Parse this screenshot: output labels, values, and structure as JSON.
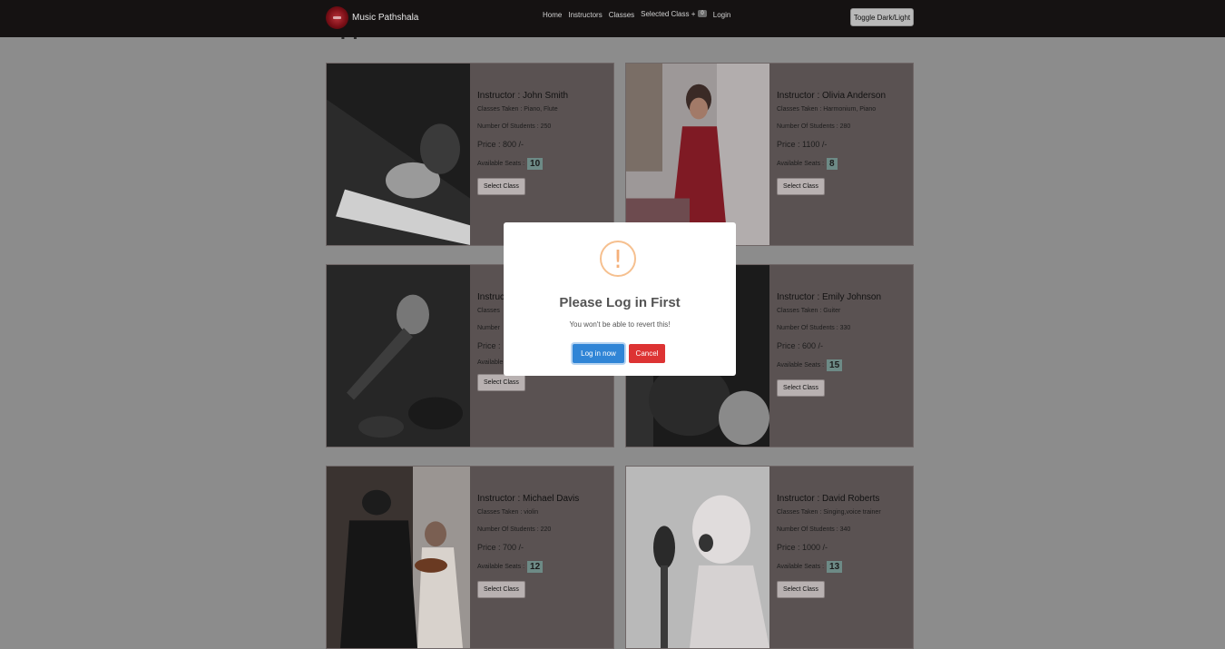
{
  "nav": {
    "brand": "Music Pathshala",
    "links": [
      "Home",
      "Instructors",
      "Classes"
    ],
    "selected_label": "Selected Class +",
    "selected_count": "0",
    "login": "Login",
    "toggle": "Toggle Dark/Light"
  },
  "cards": [
    {
      "instructor": "Instructor : John Smith",
      "classes": "Classes Taken : Piano, Flute",
      "students": "Number Of Students : 250",
      "price": "Price : 800 /-",
      "seats_label": "Available Seats :",
      "seats": "10",
      "button": "Select Class",
      "image": "piano-hands-photo"
    },
    {
      "instructor": "Instructor : Olivia Anderson",
      "classes": "Classes Taken : Harmonium, Piano",
      "students": "Number Of Students : 280",
      "price": "Price : 1100 /-",
      "seats_label": "Available Seats :",
      "seats": "8",
      "button": "Select Class",
      "image": "girl-harmonium-photo"
    },
    {
      "instructor": "Instructor :",
      "classes": "Classes",
      "students": "Number",
      "price": "Price :",
      "seats_label": "Available",
      "seats": "",
      "button": "Select Class",
      "image": "microphone-photo"
    },
    {
      "instructor": "Instructor : Emily Johnson",
      "classes": "Classes Taken : Guiter",
      "students": "Number Of Students : 330",
      "price": "Price : 600 /-",
      "seats_label": "Available Seats :",
      "seats": "15",
      "button": "Select Class",
      "image": "guitar-player-photo"
    },
    {
      "instructor": "Instructor : Michael Davis",
      "classes": "Classes Taken : violin",
      "students": "Number Of Students : 220",
      "price": "Price : 700 /-",
      "seats_label": "Available Seats :",
      "seats": "12",
      "button": "Select Class",
      "image": "violin-lesson-photo"
    },
    {
      "instructor": "Instructor : David Roberts",
      "classes": "Classes Taken : Singing,voice trainer",
      "students": "Number Of Students : 340",
      "price": "Price : 1000 /-",
      "seats_label": "Available Seats :",
      "seats": "13",
      "button": "Select Class",
      "image": "boy-singing-photo"
    }
  ],
  "modal": {
    "icon": "warning-icon",
    "icon_glyph": "!",
    "title": "Please Log in First",
    "text": "You won't be able to revert this!",
    "confirm": "Log in now",
    "cancel": "Cancel"
  },
  "colors": {
    "navbar": "#151212",
    "confirm": "#3085d6",
    "cancel": "#dd3333",
    "warning": "#f8bb86"
  }
}
